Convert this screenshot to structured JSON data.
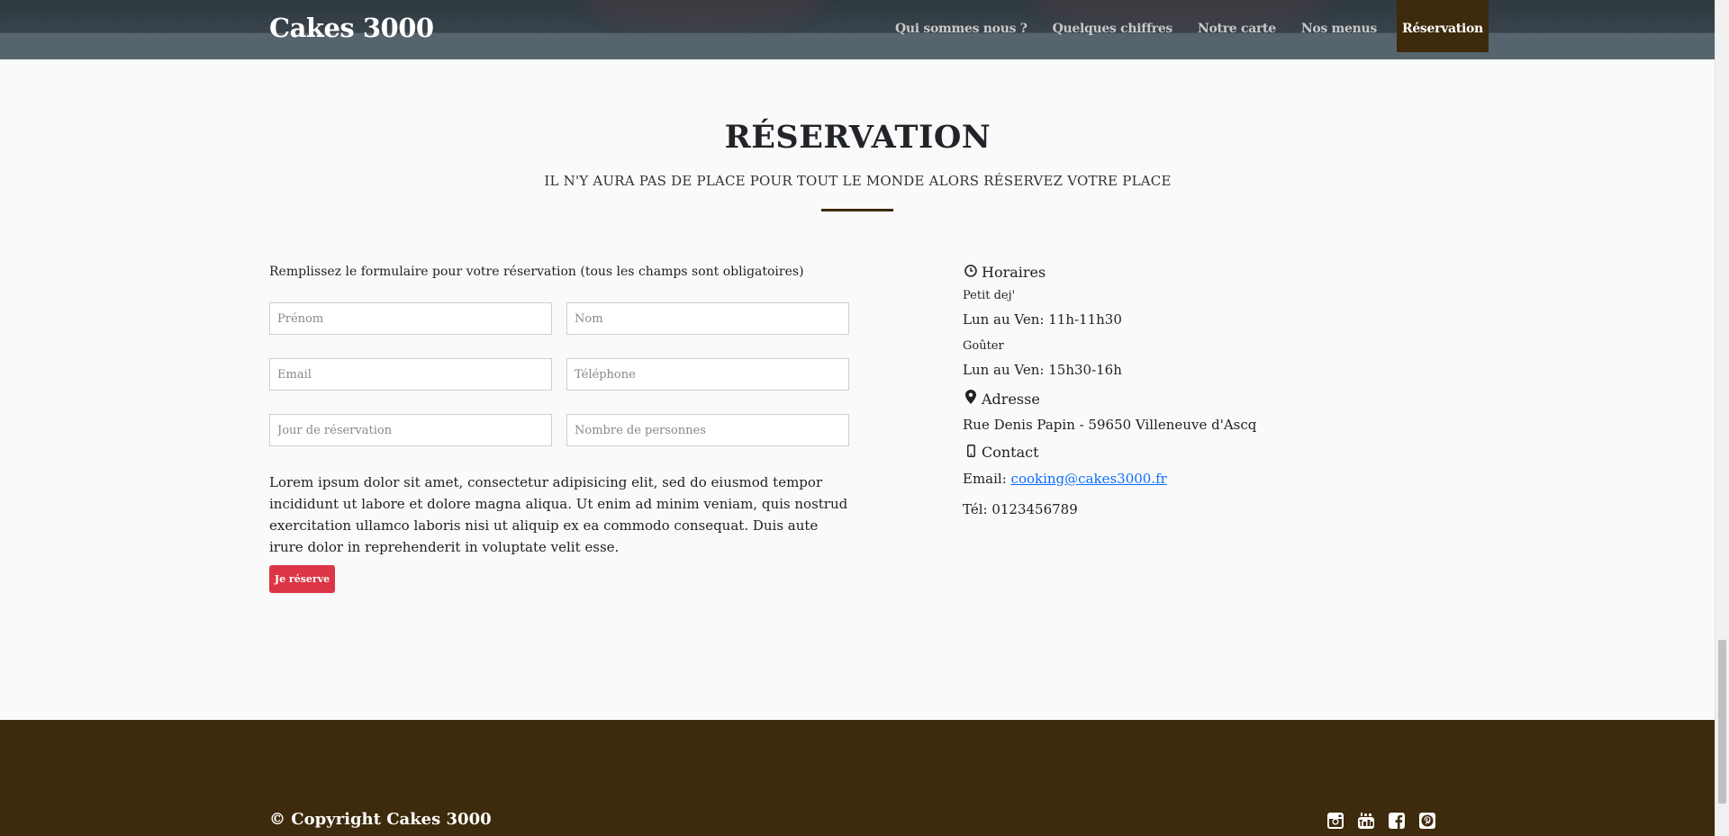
{
  "header": {
    "brand": "Cakes 3000",
    "nav": [
      {
        "label": "Qui sommes nous ?"
      },
      {
        "label": "Quelques chiffres"
      },
      {
        "label": "Notre carte"
      },
      {
        "label": "Nos menus"
      },
      {
        "label": "Réservation",
        "active": true
      }
    ]
  },
  "reservation": {
    "title": "RÉSERVATION",
    "subtitle": "IL N'Y AURA PAS DE PLACE POUR TOUT LE MONDE ALORS RÉSERVEZ VOTRE PLACE",
    "form_intro": "Remplissez le formulaire pour votre réservation (tous les champs sont obligatoires)",
    "fields": {
      "prenom": "Prénom",
      "nom": "Nom",
      "email": "Email",
      "telephone": "Téléphone",
      "jour": "Jour de réservation",
      "personnes": "Nombre de personnes"
    },
    "lorem": "Lorem ipsum dolor sit amet, consectetur adipisicing elit, sed do eiusmod tempor incididunt ut labore et dolore magna aliqua. Ut enim ad minim veniam, quis nostrud exercitation ullamco laboris nisi ut aliquip ex ea commodo consequat. Duis aute irure dolor in reprehenderit in voluptate velit esse.",
    "submit_label": "Je réserve"
  },
  "info": {
    "horaires_heading": "Horaires",
    "petit_dej_label": "Petit dej'",
    "petit_dej_hours": "Lun au Ven: 11h-11h30",
    "gouter_label": "Goûter",
    "gouter_hours": "Lun au Ven: 15h30-16h",
    "adresse_heading": "Adresse",
    "adresse": "Rue Denis Papin - 59650 Villeneuve d'Ascq",
    "contact_heading": "Contact",
    "email_label": "Email: ",
    "email": "cooking@cakes3000.fr",
    "tel": "Tél: 0123456789"
  },
  "footer": {
    "copyright": "© Copyright Cakes 3000",
    "social_icons": [
      "instagram-icon",
      "youtube-icon",
      "facebook-icon",
      "pinterest-icon"
    ]
  },
  "colors": {
    "accent_brown": "#3e2a0c",
    "button_red": "#dc3545",
    "link_blue": "#0d6efd"
  }
}
